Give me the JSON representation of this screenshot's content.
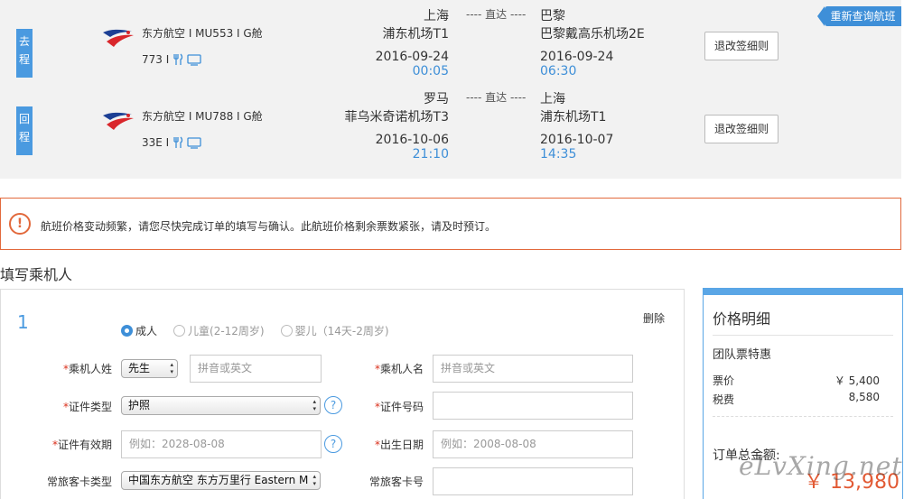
{
  "requery_label": "重新查询航班",
  "legs": [
    {
      "tag": "去程",
      "airline": "东方航空 I MU553 I G舱",
      "aircraft": "773 I",
      "from_city": "上海",
      "from_airport": "浦东机场T1",
      "direct": "---- 直达 ----",
      "to_city": "巴黎",
      "to_airport": "巴黎戴高乐机场2E",
      "dep_date": "2016-09-24",
      "dep_time": "00:05",
      "arr_date": "2016-09-24",
      "arr_time": "06:30",
      "rule_label": "退改签细则"
    },
    {
      "tag": "回程",
      "airline": "东方航空 I MU788 I G舱",
      "aircraft": "33E I",
      "from_city": "罗马",
      "from_airport": "菲乌米奇诺机场T3",
      "direct": "---- 直达 ----",
      "to_city": "上海",
      "to_airport": "浦东机场T1",
      "dep_date": "2016-10-06",
      "dep_time": "21:10",
      "arr_date": "2016-10-07",
      "arr_time": "14:35",
      "rule_label": "退改签细则"
    }
  ],
  "warning_icon": "!",
  "warning_text": "航班价格变动频繁，请您尽快完成订单的填写与确认。此航班价格剩余票数紧张，请及时预订。",
  "section_title": "填写乘机人",
  "passenger": {
    "number": "1",
    "delete_label": "删除",
    "types": [
      {
        "label": "成人",
        "active": true
      },
      {
        "label": "儿童(2-12周岁)",
        "active": false
      },
      {
        "label": "婴儿（14天-2周岁)",
        "active": false
      }
    ],
    "surname_label": "乘机人姓",
    "title_select": "先生",
    "surname_placeholder": "拼音或英文",
    "given_label": "乘机人名",
    "given_placeholder": "拼音或英文",
    "id_type_label": "证件类型",
    "id_type_value": "护照",
    "id_no_label": "证件号码",
    "id_no_value": "",
    "expiry_label": "证件有效期",
    "expiry_placeholder": "例如：2028-08-08",
    "birth_label": "出生日期",
    "birth_placeholder": "例如：2008-08-08",
    "ff_type_label": "常旅客卡类型",
    "ff_type_value": "中国东方航空 东方万里行 Eastern M",
    "ff_no_label": "常旅客卡号",
    "ff_no_value": "",
    "required_mark": "*",
    "help_mark": "?"
  },
  "price": {
    "title": "价格明细",
    "subtitle": "团队票特惠",
    "rows": [
      {
        "label": "票价",
        "value": "￥ 5,400"
      },
      {
        "label": "税费",
        "value": "8,580"
      }
    ],
    "total_label": "订单总金额:",
    "total_value": "￥ 13,980"
  },
  "watermark": "eLvXing.net",
  "colors": {
    "accent": "#3e8fd8",
    "warning": "#e2693c",
    "price": "#e25a34"
  }
}
